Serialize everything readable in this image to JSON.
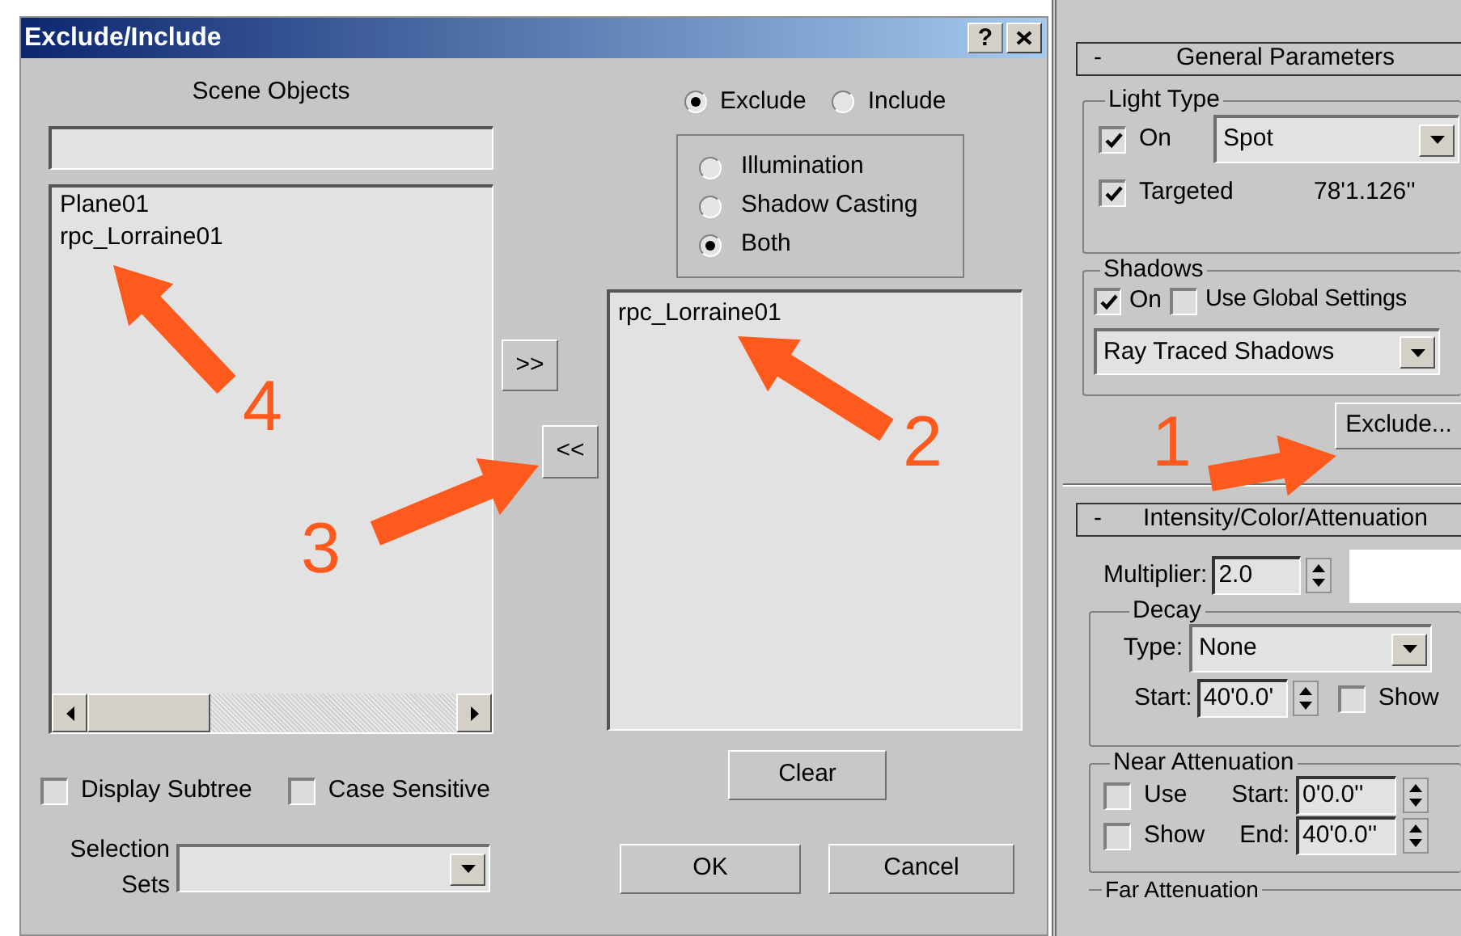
{
  "window": {
    "title": "Exclude/Include",
    "help": "?"
  },
  "scene_objects": {
    "label": "Scene Objects",
    "items": [
      "Plane01",
      "rpc_Lorraine01"
    ]
  },
  "mode": [
    {
      "label": "Exclude",
      "selected": true
    },
    {
      "label": "Include",
      "selected": false
    }
  ],
  "scope": [
    {
      "label": "Illumination",
      "selected": false
    },
    {
      "label": "Shadow Casting",
      "selected": false
    },
    {
      "label": "Both",
      "selected": true
    }
  ],
  "move_buttons": [
    ">>",
    "<<"
  ],
  "excluded": {
    "items": [
      "rpc_Lorraine01"
    ]
  },
  "options": [
    {
      "label": "Display Subtree",
      "checked": false
    },
    {
      "label": "Case Sensitive",
      "checked": false
    }
  ],
  "selection_sets": {
    "label": "Selection Sets"
  },
  "buttons": {
    "clear": "Clear",
    "ok": "OK",
    "cancel": "Cancel"
  },
  "general_parameters": {
    "toggle": "-",
    "title": "General Parameters",
    "light_type": {
      "title": "Light Type",
      "on": {
        "label": "On",
        "checked": true
      },
      "type": "Spot",
      "targeted": {
        "label": "Targeted",
        "checked": true
      },
      "distance": "78'1.126''"
    },
    "shadows": {
      "title": "Shadows",
      "on": {
        "label": "On",
        "checked": true
      },
      "use_global": {
        "label": "Use Global Settings",
        "checked": false
      },
      "type": "Ray Traced Shadows"
    },
    "exclude_button": "Exclude..."
  },
  "intensity": {
    "toggle": "-",
    "title": "Intensity/Color/Attenuation",
    "multiplier_label": "Multiplier:",
    "multiplier": "2.0",
    "decay": {
      "title": "Decay",
      "type_label": "Type:",
      "type": "None",
      "start_label": "Start:",
      "start": "40'0.0'",
      "show": {
        "label": "Show",
        "checked": false
      }
    },
    "near": {
      "title": "Near Attenuation",
      "use": {
        "label": "Use",
        "checked": false
      },
      "show": {
        "label": "Show",
        "checked": false
      },
      "start_label": "Start:",
      "start": "0'0.0''",
      "end_label": "End:",
      "end": "40'0.0''"
    },
    "far": {
      "title": "Far Attenuation"
    }
  },
  "annotations": [
    {
      "label": "4"
    },
    {
      "label": "2"
    },
    {
      "label": "3"
    },
    {
      "label": "1"
    }
  ]
}
